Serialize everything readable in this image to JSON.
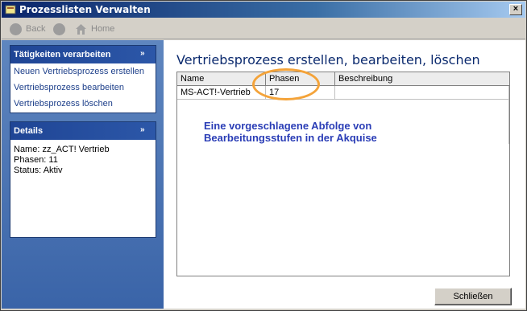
{
  "window": {
    "title": "Prozesslisten Verwalten",
    "close_glyph": "×"
  },
  "nav": {
    "back_label": "Back",
    "home_label": "Home"
  },
  "sidebar": {
    "tasks": {
      "title": "Tätigkeiten verarbeiten",
      "items": [
        {
          "label": "Neuen Vertriebsprozess erstellen"
        },
        {
          "label": "Vertriebsprozess bearbeiten"
        },
        {
          "label": "Vertriebsprozess löschen"
        }
      ]
    },
    "details": {
      "title": "Details",
      "lines": [
        "Name: zz_ACT! Vertrieb",
        "Phasen: 11",
        "Status: Aktiv"
      ]
    }
  },
  "main": {
    "title": "Vertriebsprozess erstellen, bearbeiten, löschen",
    "table": {
      "columns": [
        "Name",
        "Phasen",
        "Beschreibung"
      ],
      "rows": [
        {
          "name": "MS-ACT!-Vertrieb",
          "phasen": "17",
          "beschreibung": ""
        }
      ]
    },
    "annotation": "Eine vorgeschlagene Abfolge von Bearbeitungsstufen in der Akquise",
    "close_button": "Schließen"
  },
  "colors": {
    "accent": "#f4a339",
    "annotation": "#2a3db6",
    "sidebar": "#3a64a8"
  },
  "icons": {
    "back": "back-circle-icon",
    "forward": "forward-circle-icon",
    "home": "home-icon",
    "collapse": "chevron-double-up-icon"
  }
}
